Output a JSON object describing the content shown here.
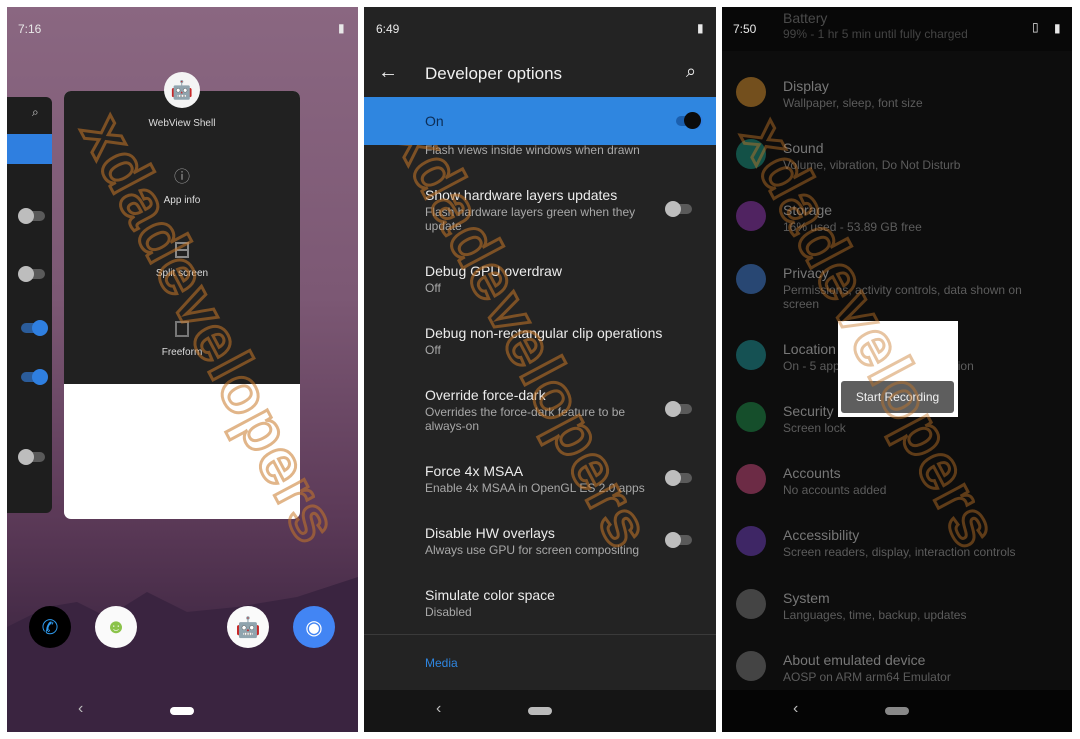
{
  "watermark": "xdadevelopers",
  "panel1": {
    "time": "7:16",
    "app_name": "WebView Shell",
    "menu": [
      {
        "label": "App info",
        "icon": "info-icon"
      },
      {
        "label": "Split screen",
        "icon": "split-screen-icon"
      },
      {
        "label": "Freeform",
        "icon": "freeform-icon"
      }
    ],
    "dock": [
      "phone",
      "messages",
      "android-app",
      "camera"
    ]
  },
  "panel2": {
    "time": "6:49",
    "title": "Developer options",
    "master": {
      "label": "On",
      "enabled": true
    },
    "items": [
      {
        "title": "",
        "subtitle": "Flash views inside windows when drawn",
        "toggle": false
      },
      {
        "title": "Show hardware layers updates",
        "subtitle": "Flash hardware layers green when they update",
        "toggle": false
      },
      {
        "title": "Debug GPU overdraw",
        "subtitle": "Off"
      },
      {
        "title": "Debug non-rectangular clip operations",
        "subtitle": "Off"
      },
      {
        "title": "Override force-dark",
        "subtitle": "Overrides the force-dark feature to be always-on",
        "toggle": false
      },
      {
        "title": "Force 4x MSAA",
        "subtitle": "Enable 4x MSAA in OpenGL ES 2.0 apps",
        "toggle": false
      },
      {
        "title": "Disable HW overlays",
        "subtitle": "Always use GPU for screen compositing",
        "toggle": false
      },
      {
        "title": "Simulate color space",
        "subtitle": "Disabled"
      }
    ],
    "section": "Media",
    "accent": "#2f86e0"
  },
  "panel3": {
    "time": "7:50",
    "items": [
      {
        "title": "Battery",
        "subtitle": "99% - 1 hr 5 min until fully charged",
        "color": "#3a3a3a"
      },
      {
        "title": "Display",
        "subtitle": "Wallpaper, sleep, font size",
        "color": "#f0a030"
      },
      {
        "title": "Sound",
        "subtitle": "Volume, vibration, Do Not Disturb",
        "color": "#1aa58f"
      },
      {
        "title": "Storage",
        "subtitle": "16% used - 53.89 GB free",
        "color": "#a23fc8"
      },
      {
        "title": "Privacy",
        "subtitle": "Permissions, activity controls, data shown on screen",
        "color": "#4a8ef0"
      },
      {
        "title": "Location",
        "subtitle": "On - 5 apps have access to location",
        "color": "#1fa3a8"
      },
      {
        "title": "Security",
        "subtitle": "Screen lock",
        "color": "#1e9e50"
      },
      {
        "title": "Accounts",
        "subtitle": "No accounts added",
        "color": "#e0508a"
      },
      {
        "title": "Accessibility",
        "subtitle": "Screen readers, display, interaction controls",
        "color": "#7a45d0"
      },
      {
        "title": "System",
        "subtitle": "Languages, time, backup, updates",
        "color": "#888888"
      },
      {
        "title": "About emulated device",
        "subtitle": "AOSP on ARM arm64 Emulator",
        "color": "#888888"
      }
    ],
    "dialog": {
      "button": "Start Recording"
    }
  }
}
